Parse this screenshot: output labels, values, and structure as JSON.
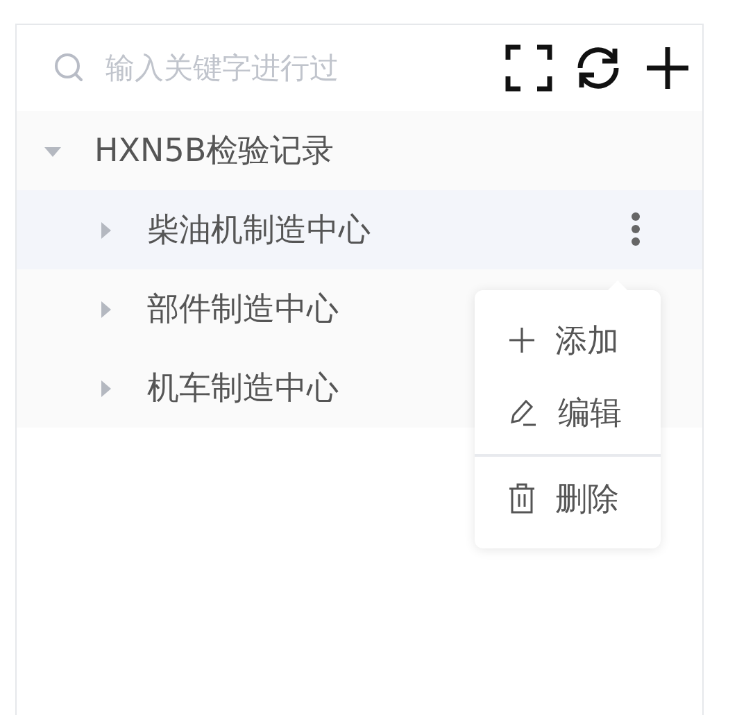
{
  "search": {
    "placeholder": "输入关键字进行过"
  },
  "toolbar": [
    {
      "kind": "fullscreen"
    },
    {
      "kind": "refresh"
    },
    {
      "kind": "add"
    }
  ],
  "tree": [
    {
      "label": "HXN5B检验记录",
      "expanded": true,
      "selected": false,
      "children": [
        {
          "label": "柴油机制造中心",
          "expanded": false,
          "selected": true
        },
        {
          "label": "部件制造中心",
          "expanded": false,
          "selected": false
        },
        {
          "label": "机车制造中心",
          "expanded": false,
          "selected": false
        }
      ]
    }
  ],
  "context_menu": [
    {
      "kind": "add",
      "label": "添加"
    },
    {
      "kind": "edit",
      "label": "编辑"
    },
    {
      "kind": "divider"
    },
    {
      "kind": "delete",
      "label": "删除"
    }
  ]
}
